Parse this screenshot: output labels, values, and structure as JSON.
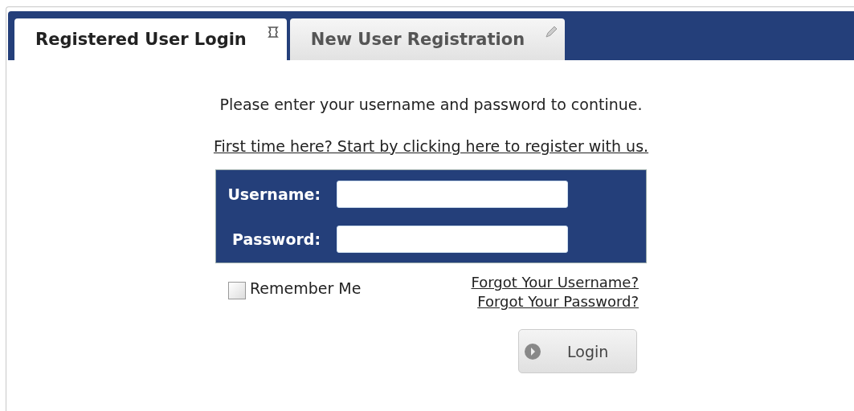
{
  "tabs": [
    {
      "label": "Registered User Login",
      "selected": true
    },
    {
      "label": "New User Registration",
      "selected": false
    }
  ],
  "intro": "Please enter your username and password to continue.",
  "register_link": "First time here? Start by clicking here to register with us.",
  "form": {
    "fields": [
      {
        "label": "Username:"
      },
      {
        "label": "Password:"
      }
    ]
  },
  "remember_me": {
    "label": "Remember Me",
    "checked": false
  },
  "links": [
    "Forgot Your Username?",
    "Forgot Your Password?"
  ],
  "login_button": "Login"
}
